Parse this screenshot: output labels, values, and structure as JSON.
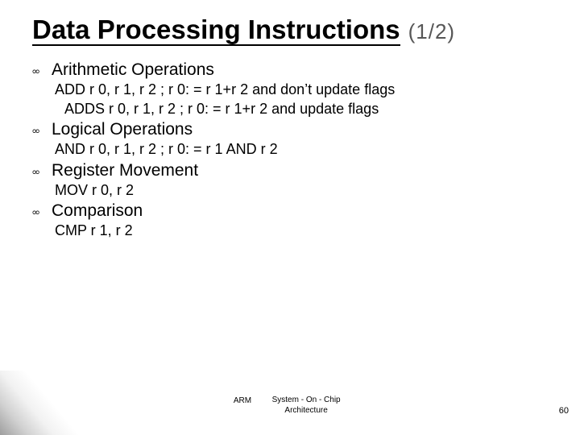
{
  "title": {
    "main": "Data Processing Instructions",
    "sub": "(1/2)"
  },
  "bullet_glyph": "｡｡",
  "sections": [
    {
      "heading": "Arithmetic Operations",
      "lines": [
        "ADD r 0, r 1, r 2   ; r 0: = r 1+r 2 and don’t update flags",
        " ADDS r 0, r 1, r 2   ; r 0: = r 1+r 2 and update flags"
      ]
    },
    {
      "heading": "Logical Operations",
      "lines": [
        "AND r 0, r 1, r 2   ; r 0: = r 1 AND r 2"
      ]
    },
    {
      "heading": "Register Movement",
      "lines": [
        "MOV r 0, r 2"
      ]
    },
    {
      "heading": "Comparison",
      "lines": [
        "CMP r 1, r 2"
      ]
    }
  ],
  "footer": {
    "arm": "ARM",
    "arch": "System - On - Chip Architecture",
    "slide_number": "60"
  }
}
